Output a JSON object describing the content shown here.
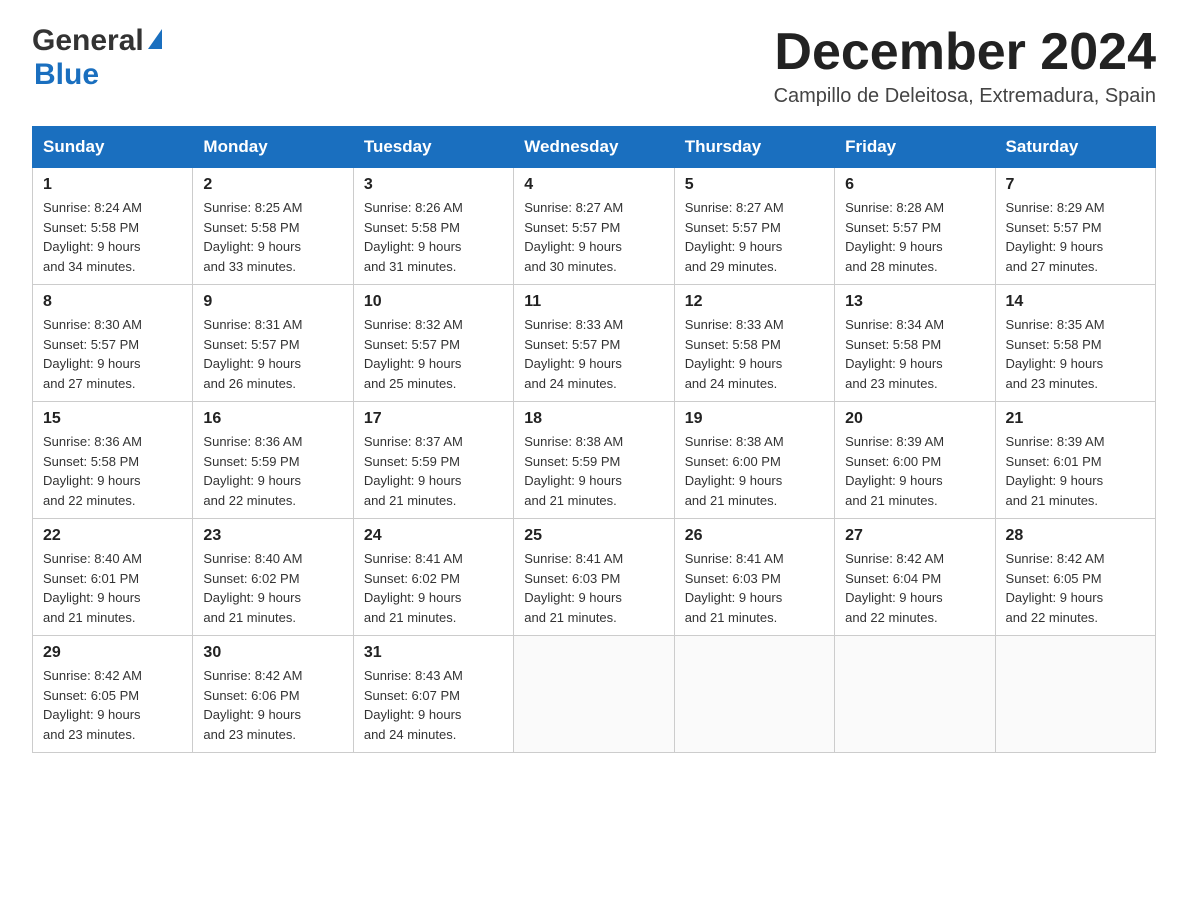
{
  "header": {
    "logo_general": "General",
    "logo_blue": "Blue",
    "month_title": "December 2024",
    "location": "Campillo de Deleitosa, Extremadura, Spain"
  },
  "days_of_week": [
    "Sunday",
    "Monday",
    "Tuesday",
    "Wednesday",
    "Thursday",
    "Friday",
    "Saturday"
  ],
  "weeks": [
    [
      {
        "day": "1",
        "sunrise": "8:24 AM",
        "sunset": "5:58 PM",
        "daylight": "9 hours and 34 minutes."
      },
      {
        "day": "2",
        "sunrise": "8:25 AM",
        "sunset": "5:58 PM",
        "daylight": "9 hours and 33 minutes."
      },
      {
        "day": "3",
        "sunrise": "8:26 AM",
        "sunset": "5:58 PM",
        "daylight": "9 hours and 31 minutes."
      },
      {
        "day": "4",
        "sunrise": "8:27 AM",
        "sunset": "5:57 PM",
        "daylight": "9 hours and 30 minutes."
      },
      {
        "day": "5",
        "sunrise": "8:27 AM",
        "sunset": "5:57 PM",
        "daylight": "9 hours and 29 minutes."
      },
      {
        "day": "6",
        "sunrise": "8:28 AM",
        "sunset": "5:57 PM",
        "daylight": "9 hours and 28 minutes."
      },
      {
        "day": "7",
        "sunrise": "8:29 AM",
        "sunset": "5:57 PM",
        "daylight": "9 hours and 27 minutes."
      }
    ],
    [
      {
        "day": "8",
        "sunrise": "8:30 AM",
        "sunset": "5:57 PM",
        "daylight": "9 hours and 27 minutes."
      },
      {
        "day": "9",
        "sunrise": "8:31 AM",
        "sunset": "5:57 PM",
        "daylight": "9 hours and 26 minutes."
      },
      {
        "day": "10",
        "sunrise": "8:32 AM",
        "sunset": "5:57 PM",
        "daylight": "9 hours and 25 minutes."
      },
      {
        "day": "11",
        "sunrise": "8:33 AM",
        "sunset": "5:57 PM",
        "daylight": "9 hours and 24 minutes."
      },
      {
        "day": "12",
        "sunrise": "8:33 AM",
        "sunset": "5:58 PM",
        "daylight": "9 hours and 24 minutes."
      },
      {
        "day": "13",
        "sunrise": "8:34 AM",
        "sunset": "5:58 PM",
        "daylight": "9 hours and 23 minutes."
      },
      {
        "day": "14",
        "sunrise": "8:35 AM",
        "sunset": "5:58 PM",
        "daylight": "9 hours and 23 minutes."
      }
    ],
    [
      {
        "day": "15",
        "sunrise": "8:36 AM",
        "sunset": "5:58 PM",
        "daylight": "9 hours and 22 minutes."
      },
      {
        "day": "16",
        "sunrise": "8:36 AM",
        "sunset": "5:59 PM",
        "daylight": "9 hours and 22 minutes."
      },
      {
        "day": "17",
        "sunrise": "8:37 AM",
        "sunset": "5:59 PM",
        "daylight": "9 hours and 21 minutes."
      },
      {
        "day": "18",
        "sunrise": "8:38 AM",
        "sunset": "5:59 PM",
        "daylight": "9 hours and 21 minutes."
      },
      {
        "day": "19",
        "sunrise": "8:38 AM",
        "sunset": "6:00 PM",
        "daylight": "9 hours and 21 minutes."
      },
      {
        "day": "20",
        "sunrise": "8:39 AM",
        "sunset": "6:00 PM",
        "daylight": "9 hours and 21 minutes."
      },
      {
        "day": "21",
        "sunrise": "8:39 AM",
        "sunset": "6:01 PM",
        "daylight": "9 hours and 21 minutes."
      }
    ],
    [
      {
        "day": "22",
        "sunrise": "8:40 AM",
        "sunset": "6:01 PM",
        "daylight": "9 hours and 21 minutes."
      },
      {
        "day": "23",
        "sunrise": "8:40 AM",
        "sunset": "6:02 PM",
        "daylight": "9 hours and 21 minutes."
      },
      {
        "day": "24",
        "sunrise": "8:41 AM",
        "sunset": "6:02 PM",
        "daylight": "9 hours and 21 minutes."
      },
      {
        "day": "25",
        "sunrise": "8:41 AM",
        "sunset": "6:03 PM",
        "daylight": "9 hours and 21 minutes."
      },
      {
        "day": "26",
        "sunrise": "8:41 AM",
        "sunset": "6:03 PM",
        "daylight": "9 hours and 21 minutes."
      },
      {
        "day": "27",
        "sunrise": "8:42 AM",
        "sunset": "6:04 PM",
        "daylight": "9 hours and 22 minutes."
      },
      {
        "day": "28",
        "sunrise": "8:42 AM",
        "sunset": "6:05 PM",
        "daylight": "9 hours and 22 minutes."
      }
    ],
    [
      {
        "day": "29",
        "sunrise": "8:42 AM",
        "sunset": "6:05 PM",
        "daylight": "9 hours and 23 minutes."
      },
      {
        "day": "30",
        "sunrise": "8:42 AM",
        "sunset": "6:06 PM",
        "daylight": "9 hours and 23 minutes."
      },
      {
        "day": "31",
        "sunrise": "8:43 AM",
        "sunset": "6:07 PM",
        "daylight": "9 hours and 24 minutes."
      },
      null,
      null,
      null,
      null
    ]
  ],
  "labels": {
    "sunrise": "Sunrise:",
    "sunset": "Sunset:",
    "daylight": "Daylight:"
  }
}
